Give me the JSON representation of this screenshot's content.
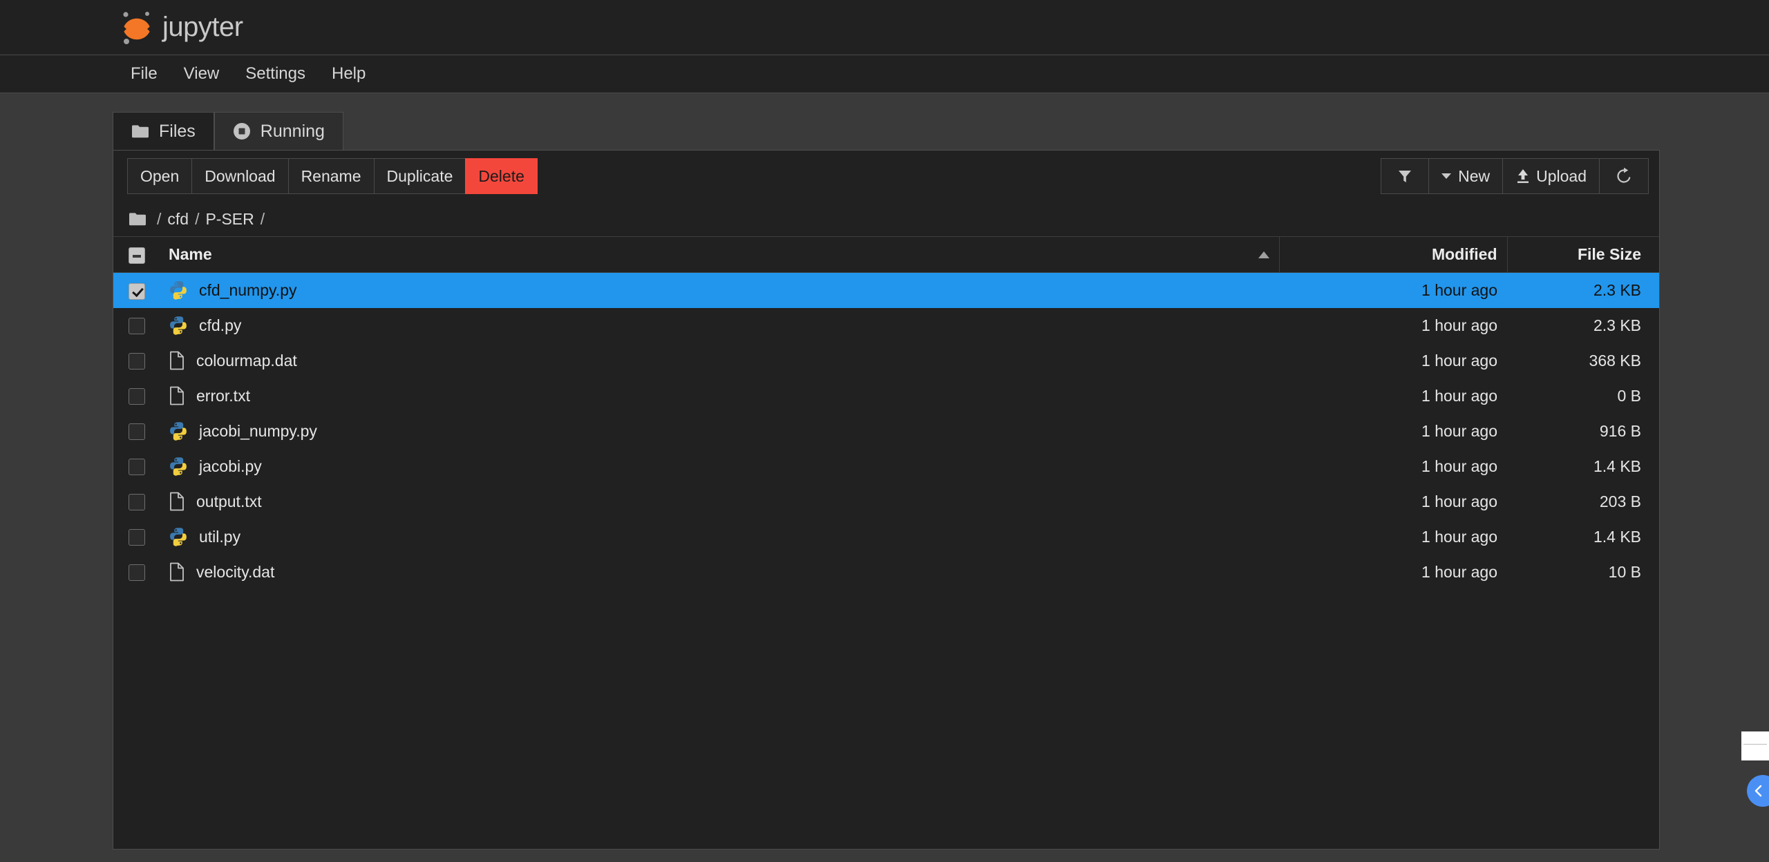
{
  "app": {
    "brand": "jupyter",
    "logo_icon": "jupyter-logo-icon"
  },
  "menubar": {
    "items": [
      {
        "label": "File"
      },
      {
        "label": "View"
      },
      {
        "label": "Settings"
      },
      {
        "label": "Help"
      }
    ]
  },
  "tabs": [
    {
      "label": "Files",
      "icon": "folder-icon",
      "active": true
    },
    {
      "label": "Running",
      "icon": "stop-circle-icon",
      "active": false
    }
  ],
  "toolbar": {
    "open_label": "Open",
    "download_label": "Download",
    "rename_label": "Rename",
    "duplicate_label": "Duplicate",
    "delete_label": "Delete",
    "delete_color": "#f4473c",
    "filter_icon": "filter-funnel-icon",
    "new_label": "New",
    "new_caret_icon": "chevron-down-icon",
    "upload_label": "Upload",
    "upload_icon": "upload-arrow-icon",
    "refresh_icon": "refresh-icon"
  },
  "breadcrumb": {
    "root_icon": "folder-icon",
    "lead_sep": "/",
    "items": [
      {
        "label": "cfd",
        "sep": "/"
      },
      {
        "label": "P-SER",
        "sep": "/"
      }
    ]
  },
  "table": {
    "headers": {
      "name": "Name",
      "modified": "Modified",
      "size": "File Size"
    },
    "sort": {
      "column": "Name",
      "direction": "asc",
      "icon": "sort-ascending-icon"
    },
    "select_all_state": "indeterminate",
    "rows": [
      {
        "name": "cfd_numpy.py",
        "icon": "python-file-icon",
        "modified": "1 hour ago",
        "size": "2.3 KB",
        "selected": true
      },
      {
        "name": "cfd.py",
        "icon": "python-file-icon",
        "modified": "1 hour ago",
        "size": "2.3 KB",
        "selected": false
      },
      {
        "name": "colourmap.dat",
        "icon": "generic-file-icon",
        "modified": "1 hour ago",
        "size": "368 KB",
        "selected": false
      },
      {
        "name": "error.txt",
        "icon": "generic-file-icon",
        "modified": "1 hour ago",
        "size": "0 B",
        "selected": false
      },
      {
        "name": "jacobi_numpy.py",
        "icon": "python-file-icon",
        "modified": "1 hour ago",
        "size": "916 B",
        "selected": false
      },
      {
        "name": "jacobi.py",
        "icon": "python-file-icon",
        "modified": "1 hour ago",
        "size": "1.4 KB",
        "selected": false
      },
      {
        "name": "output.txt",
        "icon": "generic-file-icon",
        "modified": "1 hour ago",
        "size": "203 B",
        "selected": false
      },
      {
        "name": "util.py",
        "icon": "python-file-icon",
        "modified": "1 hour ago",
        "size": "1.4 KB",
        "selected": false
      },
      {
        "name": "velocity.dat",
        "icon": "generic-file-icon",
        "modified": "1 hour ago",
        "size": "10 B",
        "selected": false
      }
    ]
  },
  "edge_widgets": {
    "panel_toggle_icon": "chevron-left-icon",
    "panel_toggle_color": "#4a90f4"
  },
  "colors": {
    "selection": "#2196ec",
    "panel_bg": "#212121",
    "page_bg": "#3a3a3a",
    "accent_orange": "#f37726"
  }
}
